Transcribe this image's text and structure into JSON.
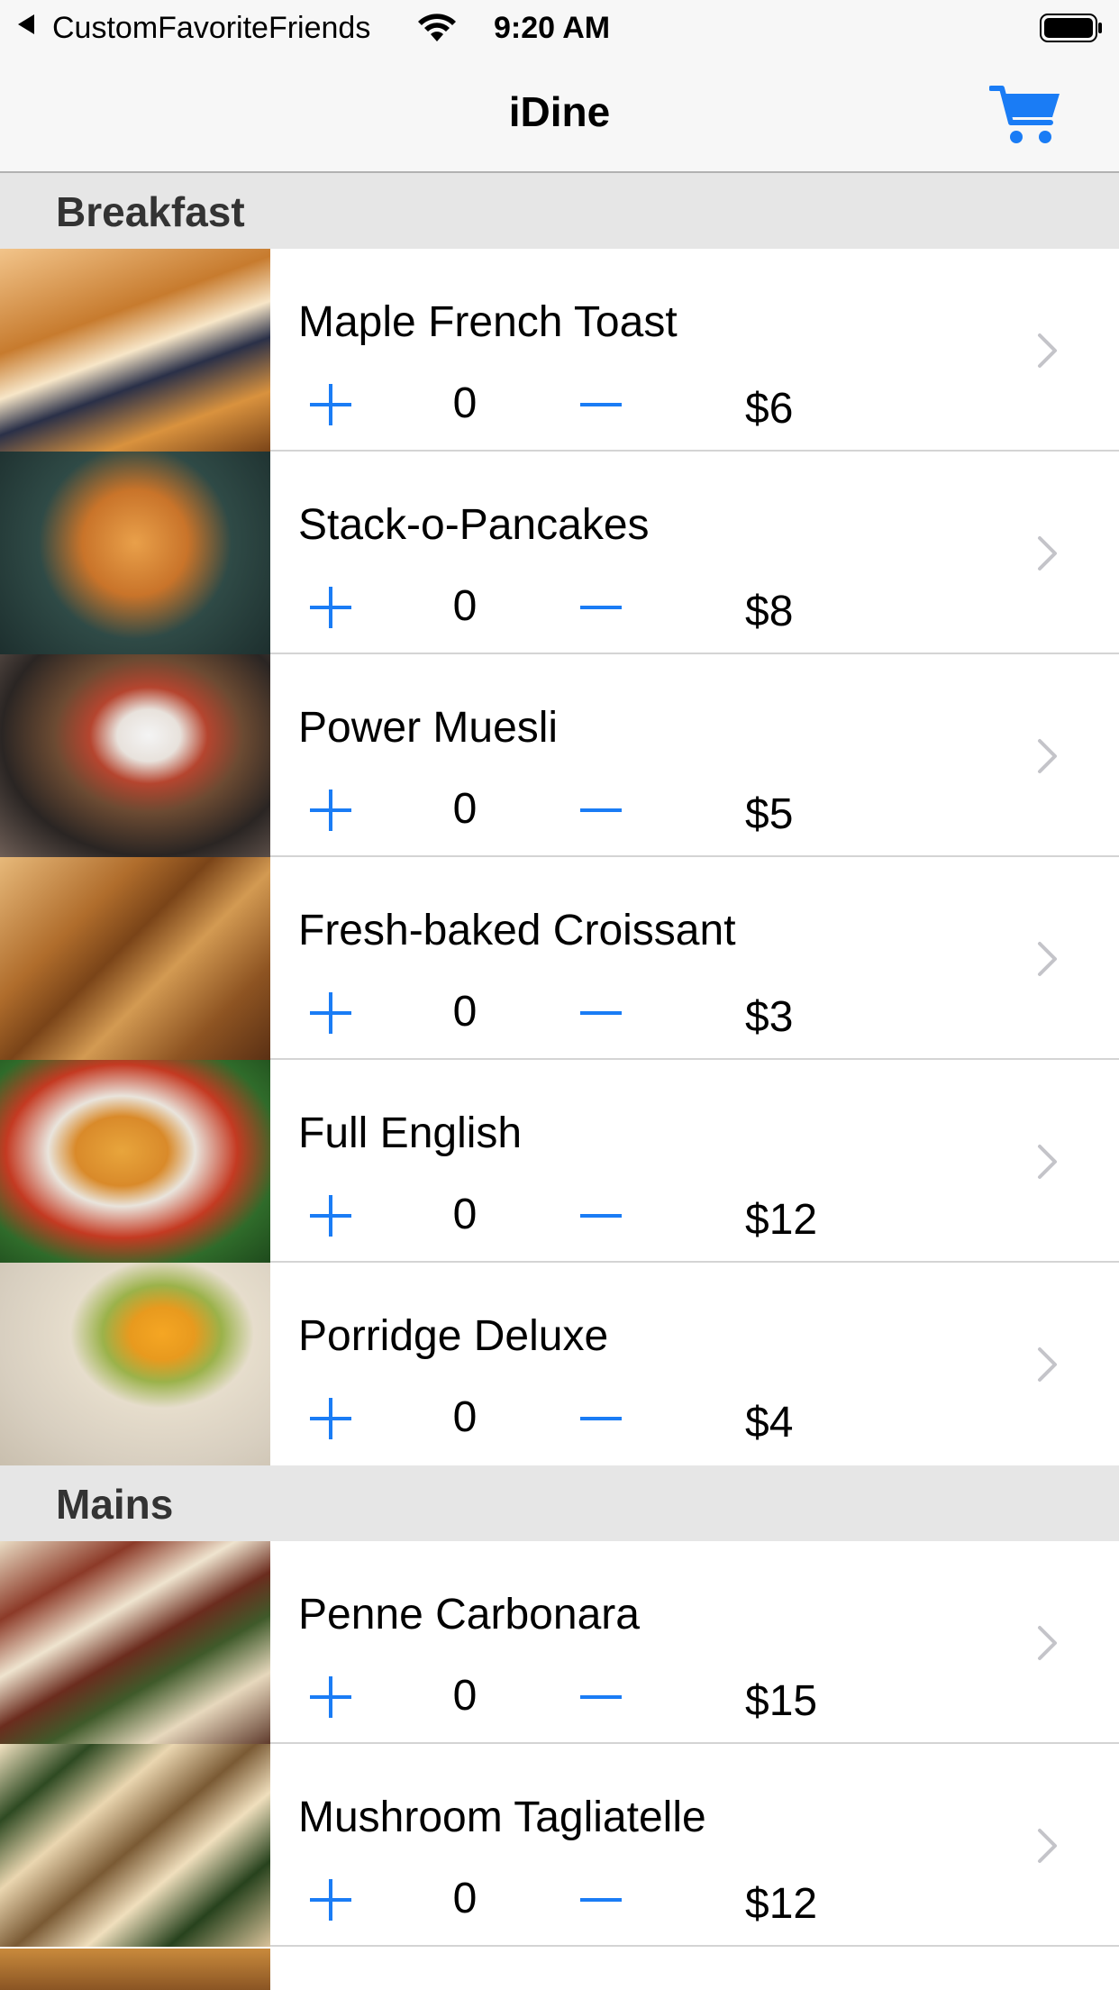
{
  "status_bar": {
    "carrier": "CustomFavoriteFriends",
    "time": "9:20 AM"
  },
  "nav": {
    "title": "iDine",
    "cart_icon": "cart-icon"
  },
  "colors": {
    "accent": "#1a7cf5",
    "section_bg": "#e6e6e6",
    "chevron": "#c4c4c9"
  },
  "sections": [
    {
      "title": "Breakfast",
      "items": [
        {
          "name": "Maple French Toast",
          "quantity": "0",
          "price": "$6"
        },
        {
          "name": "Stack-o-Pancakes",
          "quantity": "0",
          "price": "$8"
        },
        {
          "name": "Power Muesli",
          "quantity": "0",
          "price": "$5"
        },
        {
          "name": "Fresh-baked Croissant",
          "quantity": "0",
          "price": "$3"
        },
        {
          "name": "Full English",
          "quantity": "0",
          "price": "$12"
        },
        {
          "name": "Porridge Deluxe",
          "quantity": "0",
          "price": "$4"
        }
      ]
    },
    {
      "title": "Mains",
      "items": [
        {
          "name": "Penne Carbonara",
          "quantity": "0",
          "price": "$15"
        },
        {
          "name": "Mushroom Tagliatelle",
          "quantity": "0",
          "price": "$12"
        }
      ]
    }
  ]
}
